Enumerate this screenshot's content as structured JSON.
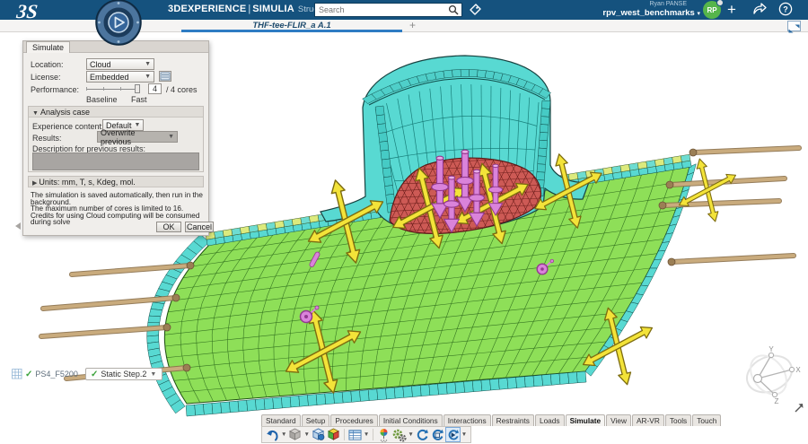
{
  "top_bar": {
    "brand": "3DEXPERIENCE",
    "divider": "|",
    "product": "SIMULIA",
    "app_title": "Structural Scenario Creation",
    "user_name": "Ryan PANSE",
    "workspace": "rpv_west_benchmarks",
    "avatar_initials": "RP",
    "plus_label": "+"
  },
  "search": {
    "placeholder": "Search"
  },
  "doc_tab": {
    "label": "THF-tee-FLIR_a A.1",
    "new_tab_label": "+"
  },
  "panel": {
    "tab": "Simulate",
    "location_label": "Location:",
    "location_value": "Cloud",
    "license_label": "License:",
    "license_value": "Embedded",
    "performance_label": "Performance:",
    "cores_value": "4",
    "cores_suffix": "/ 4 cores",
    "scale_min": "Baseline",
    "scale_max": "Fast",
    "analysis_case": {
      "header": "Analysis case",
      "experience_label": "Experience content:",
      "experience_value": "Default",
      "results_label": "Results:",
      "results_value": "Overwrite previous",
      "description_label": "Description for previous results:"
    },
    "units_header": "Units: mm, T, s, Kdeg, mol.",
    "notes": [
      "The simulation is saved automatically, then run in the background.",
      "The maximum number of cores is limited to 16.",
      "Credits for using Cloud computing will be consumed during solve"
    ],
    "ok_label": "OK",
    "cancel_label": "Cancel"
  },
  "status_bar": {
    "mesh_name": "PS4_F5200",
    "step_name": "Static Step.2"
  },
  "action_bar": {
    "tabs": [
      "Standard",
      "Setup",
      "Procedures",
      "Initial Conditions",
      "Interactions",
      "Restraints",
      "Loads",
      "Simulate",
      "View",
      "AR-VR",
      "Tools",
      "Touch"
    ],
    "active_tab": "Simulate",
    "icon_names": [
      "undo",
      "model",
      "scenario",
      "results",
      "table",
      "probe",
      "settings-gears",
      "refresh",
      "update",
      "simulate-play"
    ]
  },
  "compass": {
    "x": "X",
    "y": "Y",
    "z": "Z"
  },
  "viewport": {
    "colors": {
      "green": "#8edf58",
      "greenLine": "#2e6b1d",
      "greenEdge": "#1d4f12",
      "cyan": "#58d9d2",
      "cyanLine": "#14504c",
      "cyanRim": "#4fcfc9",
      "checker1": "#dcea7d",
      "checker2": "#6ddcd1",
      "red": "#cd5a55",
      "redLine": "#6e1f1c",
      "yellow": "#f3e339",
      "yellowEdge": "#7d6c10",
      "pink": "#da83da",
      "pinkEdge": "#93388f",
      "tan": "#c9ab7d",
      "tanDark": "#8a6f4a"
    }
  }
}
